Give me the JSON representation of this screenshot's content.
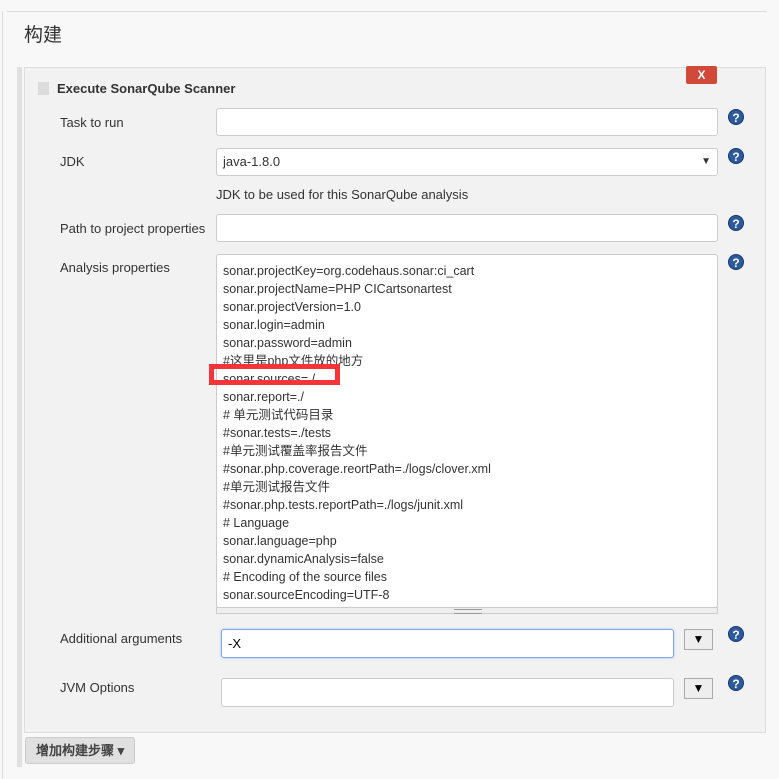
{
  "section_title": "构建",
  "step": {
    "title": "Execute SonarQube Scanner",
    "delete_label": "X",
    "fields": {
      "task_to_run": {
        "label": "Task to run",
        "value": ""
      },
      "jdk": {
        "label": "JDK",
        "value": "java-1.8.0",
        "hint": "JDK to be used for this SonarQube analysis"
      },
      "path": {
        "label": "Path to project properties",
        "value": ""
      },
      "analysis": {
        "label": "Analysis properties",
        "value": "sonar.projectKey=org.codehaus.sonar:ci_cart\nsonar.projectName=PHP CICartsonartest\nsonar.projectVersion=1.0\nsonar.login=admin\nsonar.password=admin\n#这里是php文件放的地方\nsonar.sources=./\nsonar.report=./\n# 单元测试代码目录\n#sonar.tests=./tests\n#单元测试覆盖率报告文件\n#sonar.php.coverage.reortPath=./logs/clover.xml\n#单元测试报告文件\n#sonar.php.tests.reportPath=./logs/junit.xml\n# Language\nsonar.language=php\nsonar.dynamicAnalysis=false\n# Encoding of the source files\nsonar.sourceEncoding=UTF-8"
      },
      "additional": {
        "label": "Additional arguments",
        "value": "-X"
      },
      "jvm": {
        "label": "JVM Options",
        "value": ""
      }
    },
    "help_glyph": "?",
    "dropdown_glyph": "▼"
  },
  "add_step_label": "增加构建步骤 ▾",
  "colors": {
    "danger": "#d24939",
    "highlight": "#f4333a",
    "help": "#2d5a9e"
  }
}
